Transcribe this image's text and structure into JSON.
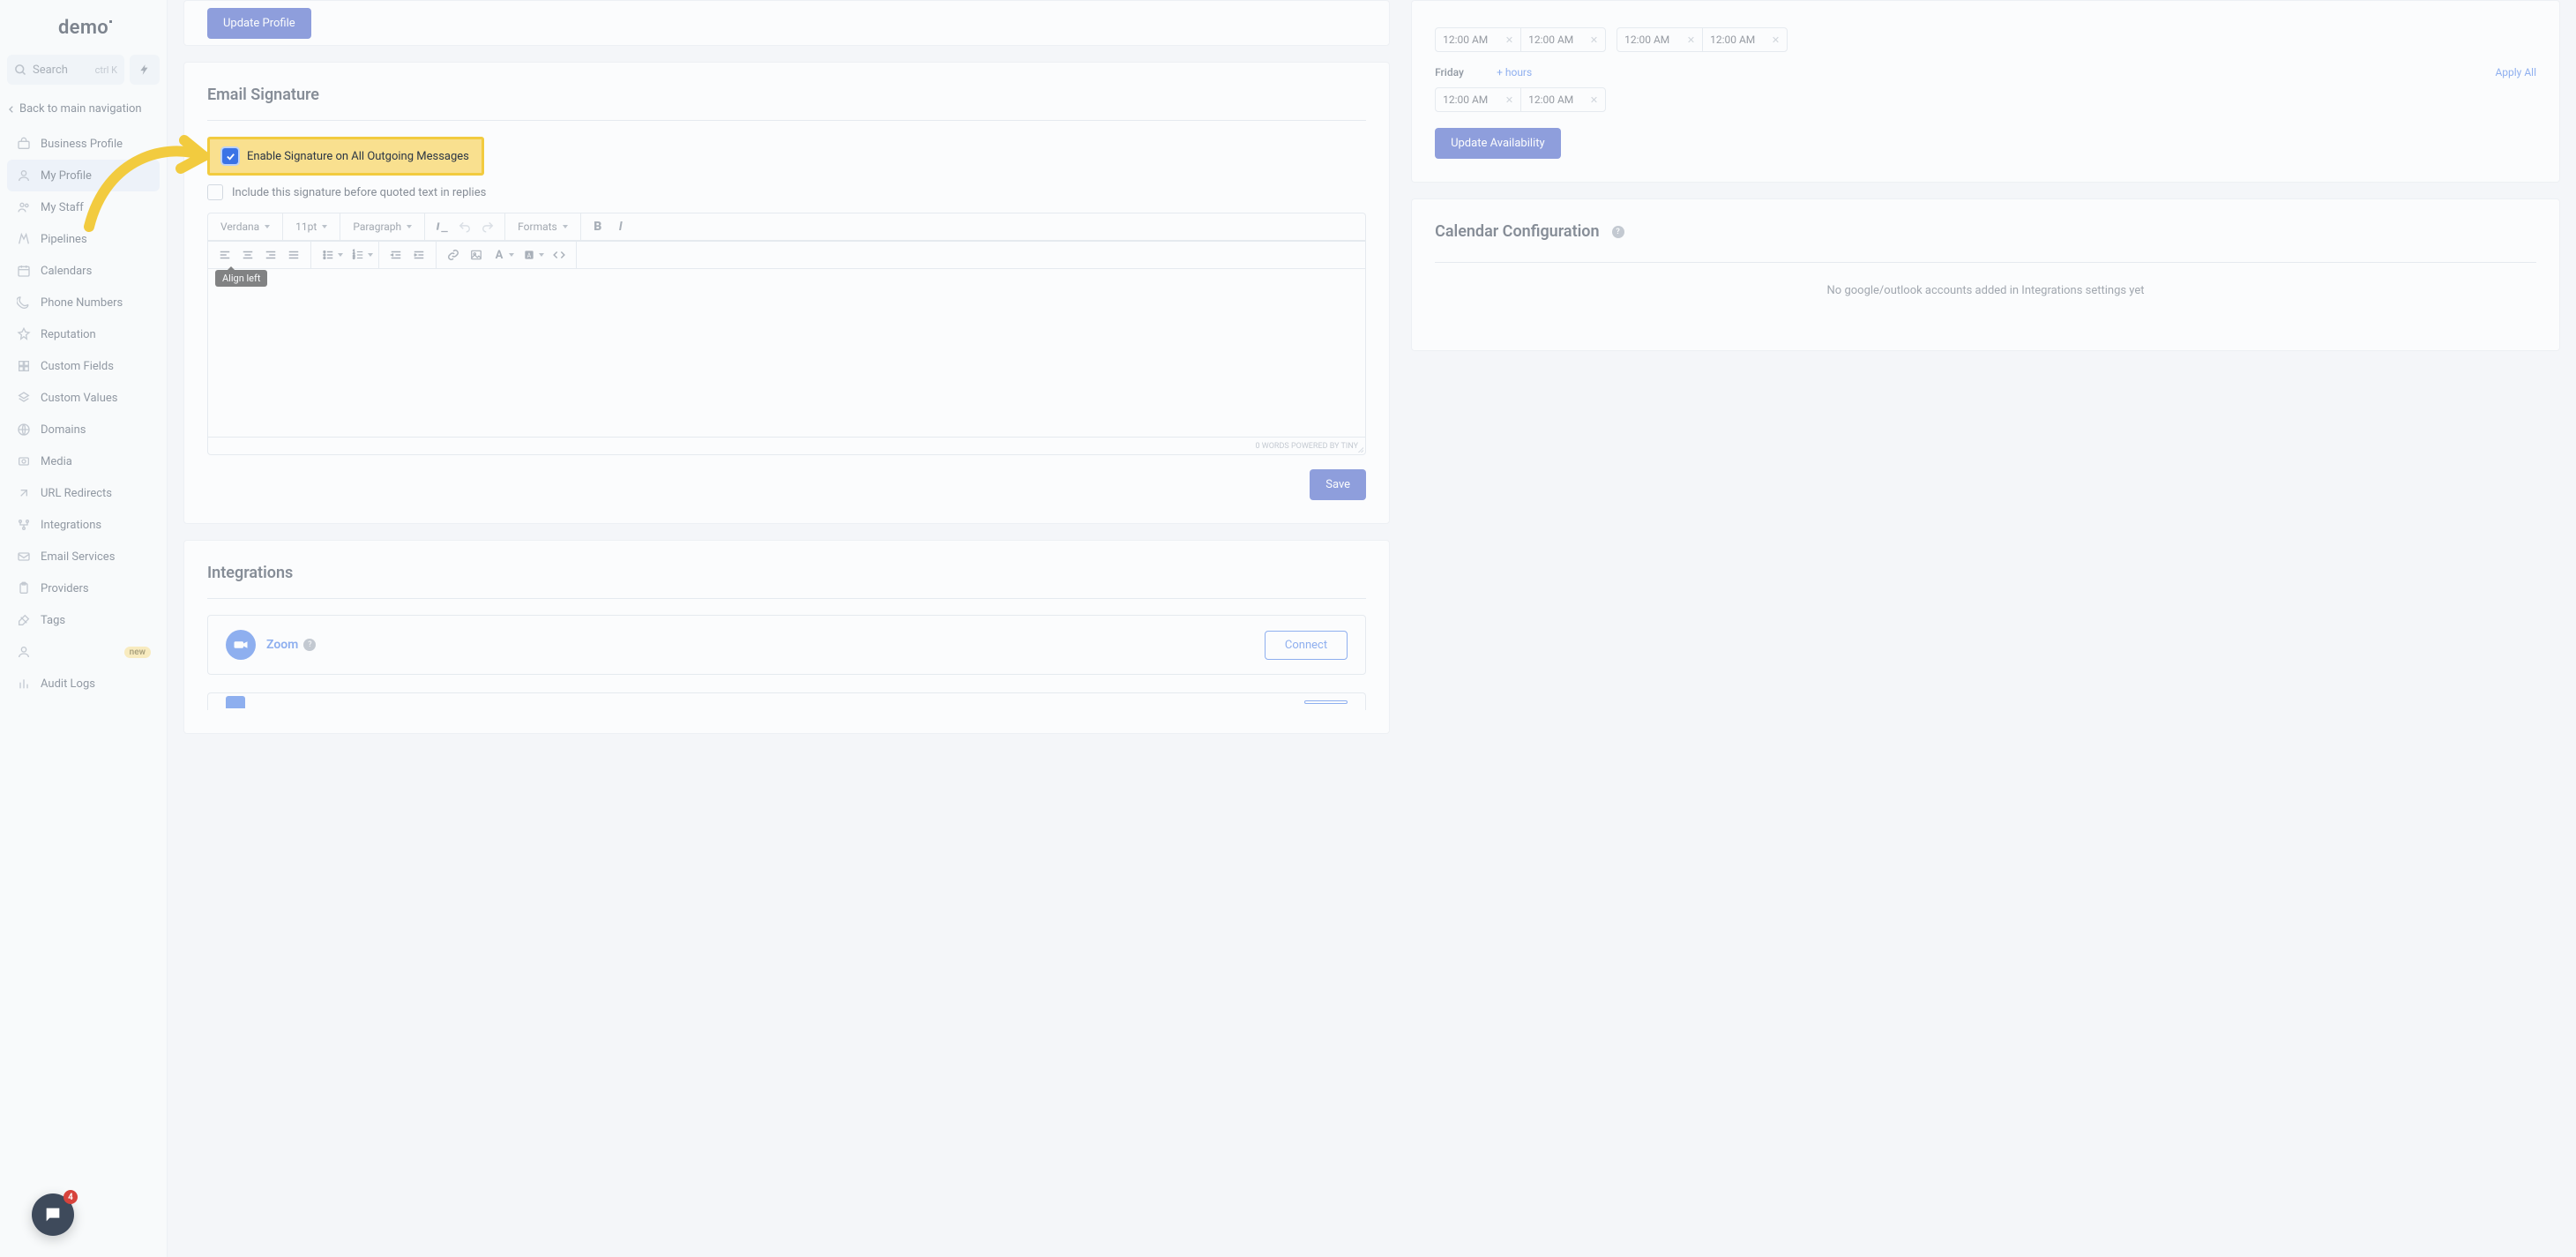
{
  "brand": {
    "logo_text": "demo"
  },
  "search": {
    "placeholder": "Search",
    "kbd": "ctrl K"
  },
  "back_nav": "Back to main navigation",
  "nav": [
    {
      "label": "Business Profile"
    },
    {
      "label": "My Profile",
      "active": true
    },
    {
      "label": "My Staff"
    },
    {
      "label": "Pipelines"
    },
    {
      "label": "Calendars"
    },
    {
      "label": "Phone Numbers"
    },
    {
      "label": "Reputation"
    },
    {
      "label": "Custom Fields"
    },
    {
      "label": "Custom Values"
    },
    {
      "label": "Domains"
    },
    {
      "label": "Media"
    },
    {
      "label": "URL Redirects"
    },
    {
      "label": "Integrations"
    },
    {
      "label": "Email Services"
    },
    {
      "label": "Providers"
    },
    {
      "label": "Tags"
    },
    {
      "label": "",
      "badge": "new"
    },
    {
      "label": "Audit Logs"
    }
  ],
  "chat_badge": "4",
  "profile_card": {
    "button": "Update Profile"
  },
  "signature": {
    "title": "Email Signature",
    "enable_label": "Enable Signature on All Outgoing Messages",
    "include_label": "Include this signature before quoted text in replies",
    "font_family": "Verdana",
    "font_size": "11pt",
    "block": "Paragraph",
    "formats": "Formats",
    "tooltip": "Align left",
    "footer_words": "0 WORDS",
    "footer_powered": "POWERED BY TINY",
    "save": "Save"
  },
  "integrations_section": {
    "title": "Integrations",
    "zoom": "Zoom",
    "connect": "Connect"
  },
  "availability": {
    "rows": [
      {
        "start": "12:00 AM",
        "end": "12:00 AM",
        "start2": "12:00 AM",
        "end2": "12:00 AM"
      }
    ],
    "friday_label": "Friday",
    "plus_hours": "+ hours",
    "apply_all": "Apply All",
    "friday": {
      "start": "12:00 AM",
      "end": "12:00 AM"
    },
    "update": "Update Availability"
  },
  "calendar": {
    "title": "Calendar Configuration",
    "empty": "No google/outlook accounts added in Integrations settings yet"
  }
}
